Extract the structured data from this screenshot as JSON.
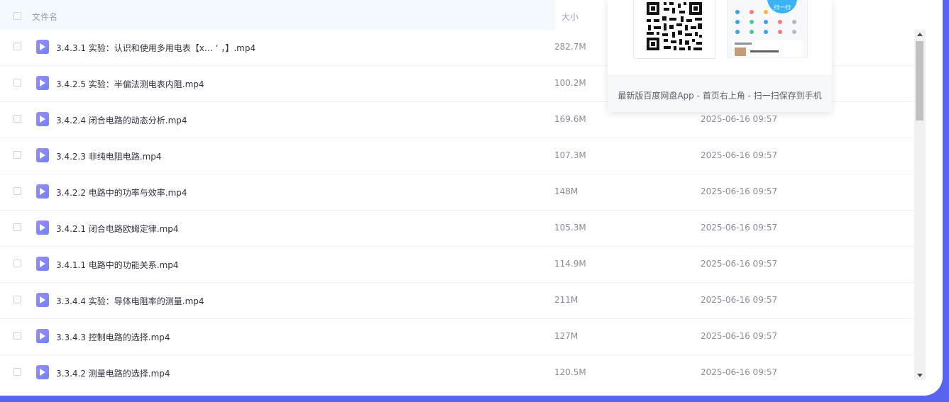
{
  "header": {
    "col_name": "文件名",
    "col_size": "大小"
  },
  "files": [
    {
      "name": "3.4.3.1 实验：认识和使用多用电表【x…  ‘   ，】.mp4",
      "size": "282.7M",
      "date": ""
    },
    {
      "name": "3.4.2.5 实验：半偏法测电表内阻.mp4",
      "size": "100.2M",
      "date": ""
    },
    {
      "name": "3.4.2.4 闭合电路的动态分析.mp4",
      "size": "169.6M",
      "date": "2025-06-16 09:57"
    },
    {
      "name": "3.4.2.3 非纯电阻电路.mp4",
      "size": "107.3M",
      "date": "2025-06-16 09:57"
    },
    {
      "name": "3.4.2.2 电路中的功率与效率.mp4",
      "size": "148M",
      "date": "2025-06-16 09:57"
    },
    {
      "name": "3.4.2.1 闭合电路欧姆定律.mp4",
      "size": "105.3M",
      "date": "2025-06-16 09:57"
    },
    {
      "name": "3.4.1.1 电路中的功能关系.mp4",
      "size": "114.9M",
      "date": "2025-06-16 09:57"
    },
    {
      "name": "3.3.4.4 实验：导体电阻率的测量.mp4",
      "size": "211M",
      "date": "2025-06-16 09:57"
    },
    {
      "name": "3.3.4.3 控制电路的选择.mp4",
      "size": "127M",
      "date": "2025-06-16 09:57"
    },
    {
      "name": "3.3.4.2 测量电路的选择.mp4",
      "size": "120.5M",
      "date": "2025-06-16 09:57"
    }
  ],
  "popup": {
    "scan_label": "扫一扫",
    "text": "最新版百度网盘App - 首页右上角 - 扫一扫保存到手机"
  },
  "colors": {
    "frame": "#5864f0",
    "header_bg": "#f4f8ff",
    "icon": "#8a88fa"
  }
}
